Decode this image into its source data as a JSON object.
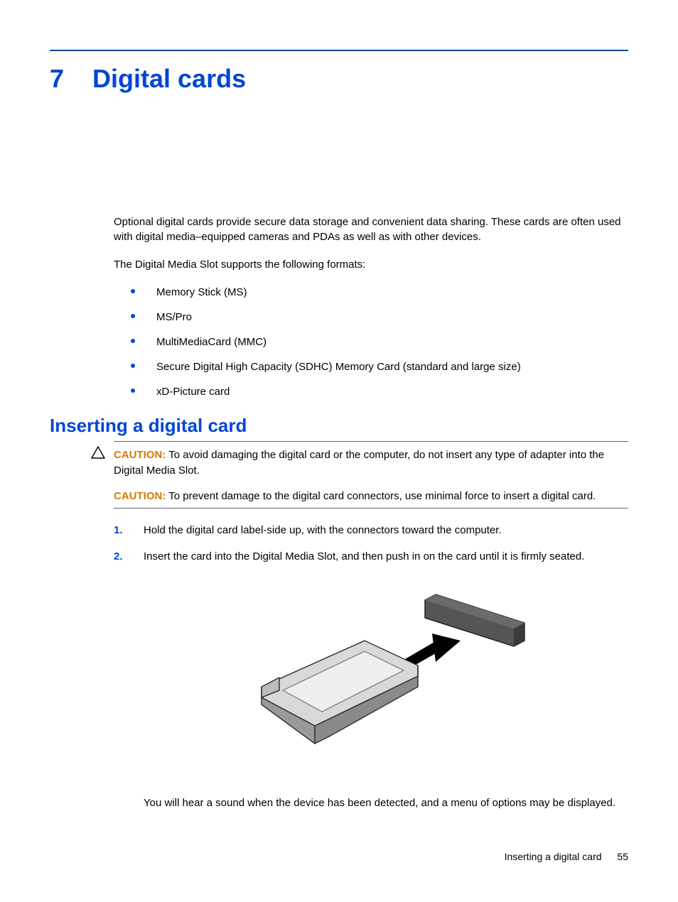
{
  "chapter": {
    "number": "7",
    "title": "Digital cards"
  },
  "intro": {
    "p1": "Optional digital cards provide secure data storage and convenient data sharing. These cards are often used with digital media–equipped cameras and PDAs as well as with other devices.",
    "p2": "The Digital Media Slot supports the following formats:"
  },
  "formats": [
    "Memory Stick (MS)",
    "MS/Pro",
    "MultiMediaCard (MMC)",
    "Secure Digital High Capacity (SDHC) Memory Card (standard and large size)",
    "xD-Picture card"
  ],
  "section": {
    "heading": "Inserting a digital card",
    "caution1_label": "CAUTION:",
    "caution1_text": "To avoid damaging the digital card or the computer, do not insert any type of adapter into the Digital Media Slot.",
    "caution2_label": "CAUTION:",
    "caution2_text": "To prevent damage to the digital card connectors, use minimal force to insert a digital card.",
    "steps": [
      {
        "num": "1.",
        "text": "Hold the digital card label-side up, with the connectors toward the computer."
      },
      {
        "num": "2.",
        "text": "Insert the card into the Digital Media Slot, and then push in on the card until it is firmly seated."
      }
    ],
    "after_note": "You will hear a sound when the device has been detected, and a menu of options may be displayed."
  },
  "footer": {
    "section_name": "Inserting a digital card",
    "page": "55"
  }
}
